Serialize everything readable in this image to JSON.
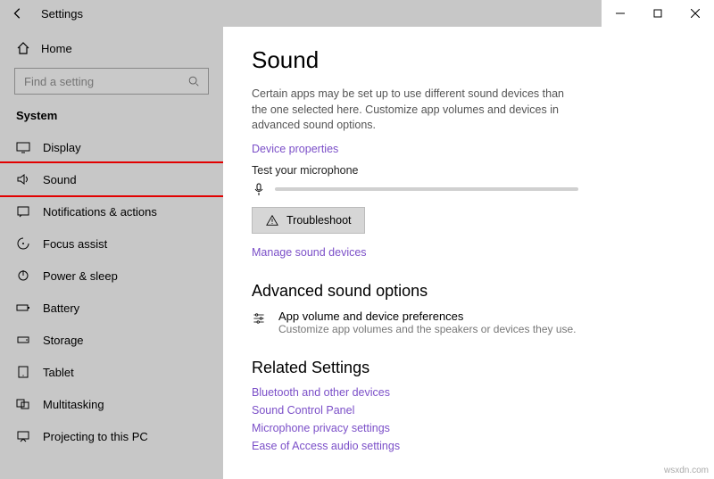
{
  "titlebar": {
    "title": "Settings"
  },
  "sidebar": {
    "home_label": "Home",
    "search_placeholder": "Find a setting",
    "category_label": "System",
    "items": [
      {
        "label": "Display"
      },
      {
        "label": "Sound"
      },
      {
        "label": "Notifications & actions"
      },
      {
        "label": "Focus assist"
      },
      {
        "label": "Power & sleep"
      },
      {
        "label": "Battery"
      },
      {
        "label": "Storage"
      },
      {
        "label": "Tablet"
      },
      {
        "label": "Multitasking"
      },
      {
        "label": "Projecting to this PC"
      }
    ]
  },
  "content": {
    "heading": "Sound",
    "description": "Certain apps may be set up to use different sound devices than the one selected here. Customize app volumes and devices in advanced sound options.",
    "device_properties_link": "Device properties",
    "test_mic_label": "Test your microphone",
    "troubleshoot_button": "Troubleshoot",
    "manage_devices_link": "Manage sound devices",
    "advanced_heading": "Advanced sound options",
    "pref_title": "App volume and device preferences",
    "pref_sub": "Customize app volumes and the speakers or devices they use.",
    "related_heading": "Related Settings",
    "related_links": {
      "bluetooth": "Bluetooth and other devices",
      "control_panel": "Sound Control Panel",
      "mic_privacy": "Microphone privacy settings",
      "ease_of_access": "Ease of Access audio settings"
    }
  },
  "watermark": "wsxdn.com"
}
